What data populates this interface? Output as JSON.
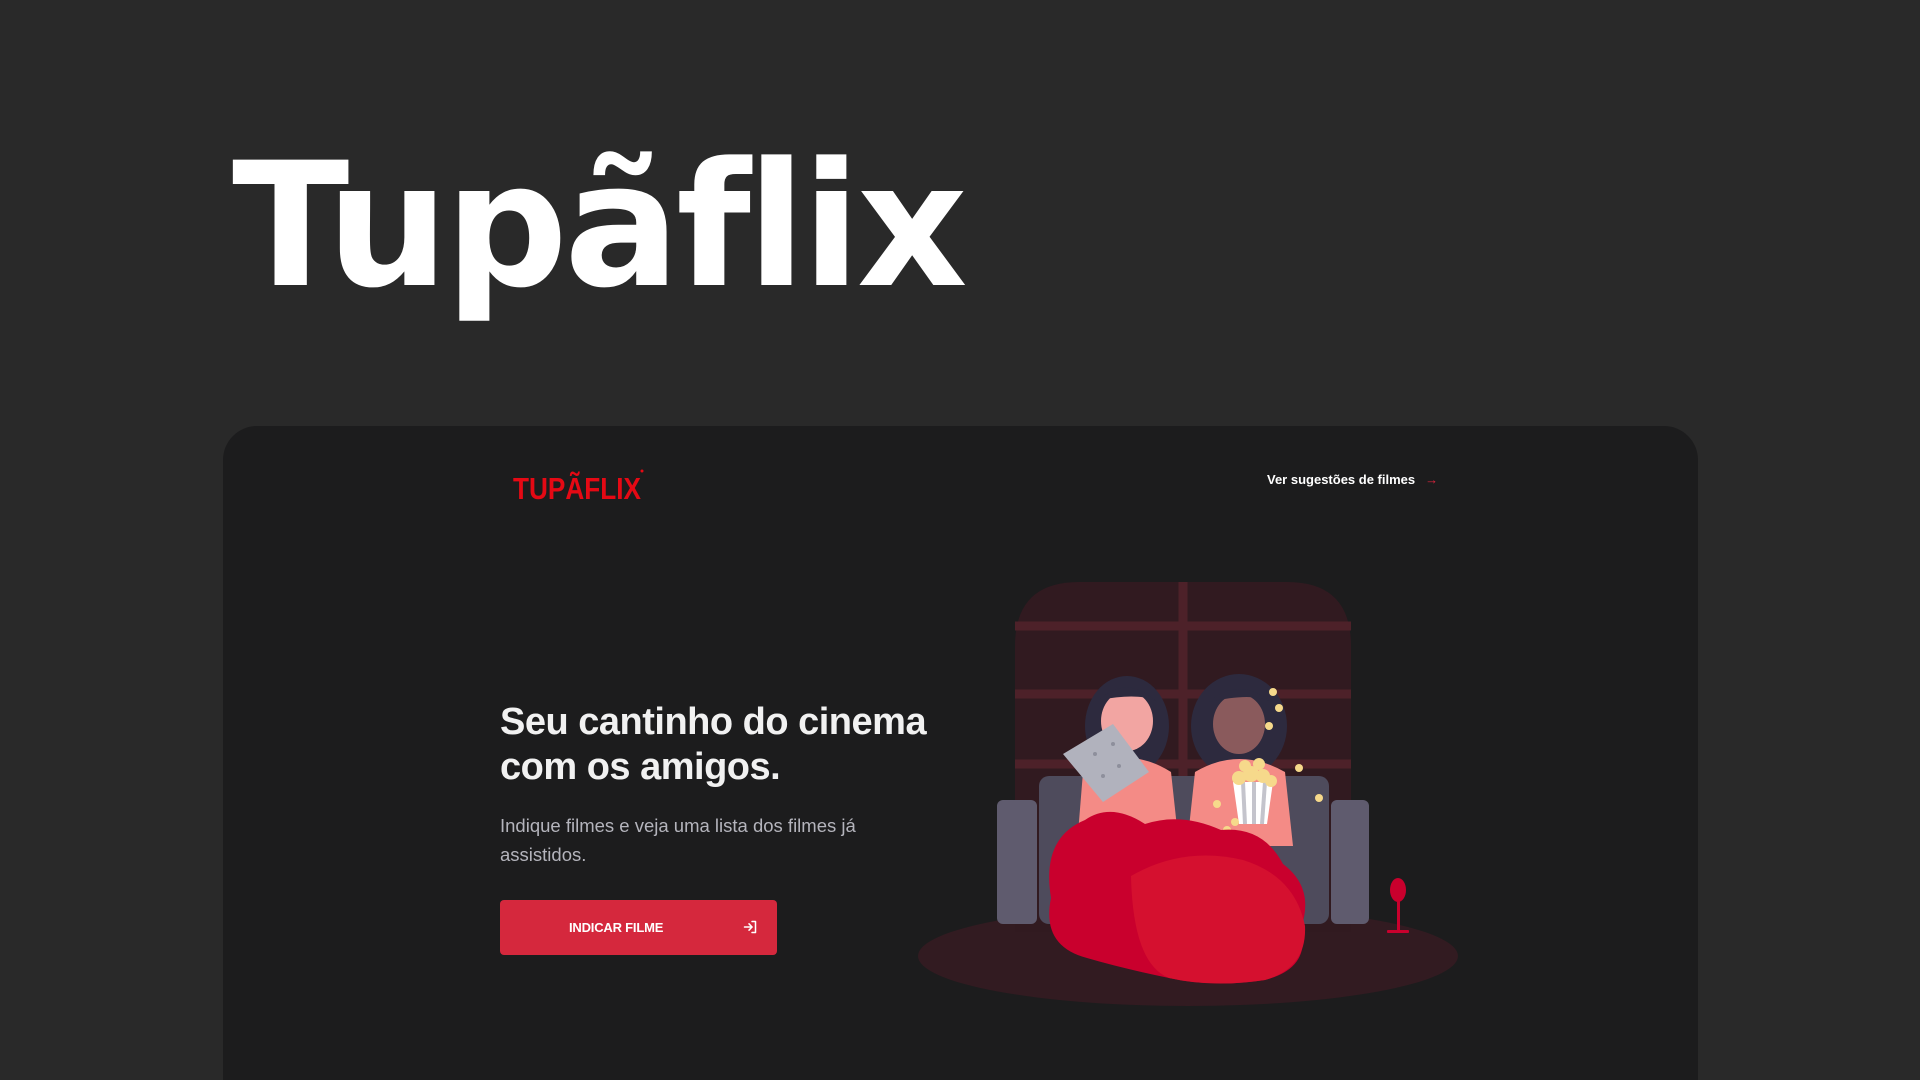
{
  "hero": {
    "title": "Tupãflix"
  },
  "app": {
    "logo_text": "TUPÃFLIX",
    "nav_link": "Ver sugestões de filmes",
    "nav_link_icon": "arrow-right-icon",
    "headline": "Seu cantinho do cinema com os amigos.",
    "subtitle": "Indique filmes e veja uma lista dos filmes já assistidos.",
    "cta_label": "INDICAR FILME",
    "cta_icon": "sign-in-icon"
  },
  "colors": {
    "background": "#292929",
    "device_background": "#1c1c1d",
    "accent": "#d5283d",
    "logo_red": "#e50914",
    "text_primary": "#ffffff",
    "text_secondary": "#b4b4bc"
  }
}
